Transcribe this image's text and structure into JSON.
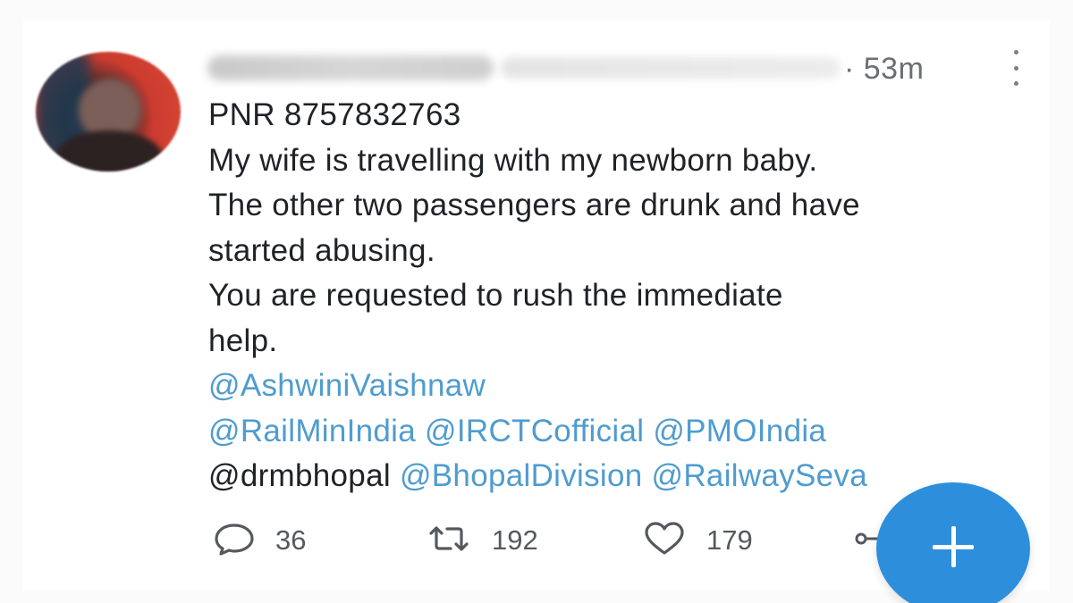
{
  "tweet": {
    "timestamp": "· 53m",
    "lines": [
      {
        "text": "PNR 8757832763"
      },
      {
        "text": "My wife is travelling with my newborn baby."
      },
      {
        "text": "The other two passengers are drunk and have"
      },
      {
        "text": "started abusing."
      },
      {
        "text": "You are requested to rush the immediate"
      },
      {
        "text": "help."
      }
    ],
    "mentions": {
      "line1": [
        "@AshwiniVaishnaw"
      ],
      "line2": [
        "@RailMinIndia",
        "@IRCTCofficial",
        "@PMOIndia"
      ],
      "line3_dark": "@drmbhopal",
      "line3": [
        "@BhopalDivision",
        "@RailwaySeva"
      ]
    }
  },
  "actions": {
    "reply_count": "36",
    "retweet_count": "192",
    "like_count": "179"
  },
  "icons": {
    "reply": "reply-icon",
    "retweet": "retweet-icon",
    "like": "heart-icon",
    "share": "share-icon",
    "more": "more-vertical-icon",
    "compose": "plus-icon"
  },
  "colors": {
    "mention": "#4f9ccf",
    "fab": "#2d8fdc",
    "text": "#1f2226",
    "muted": "#6b6f74"
  }
}
